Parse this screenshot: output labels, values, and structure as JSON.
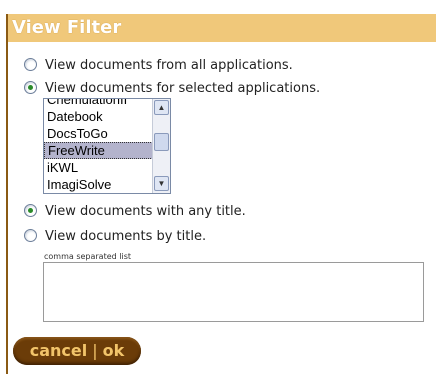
{
  "dialog": {
    "title": "View Filter"
  },
  "options": {
    "all_apps": "View documents from all applications.",
    "selected_apps": "View documents for selected applications.",
    "any_title": "View documents with any title.",
    "by_title": "View documents by title."
  },
  "selection": {
    "application_scope": "selected_apps",
    "title_scope": "any_title"
  },
  "app_list": {
    "items": [
      "ChemulationII",
      "Datebook",
      "DocsToGo",
      "FreeWrite",
      "iKWL",
      "ImagiSolve"
    ],
    "selected": "FreeWrite"
  },
  "title_filter": {
    "label": "comma separated list",
    "value": ""
  },
  "buttons": {
    "cancel_label": "cancel",
    "separator": "|",
    "ok_label": "ok"
  }
}
